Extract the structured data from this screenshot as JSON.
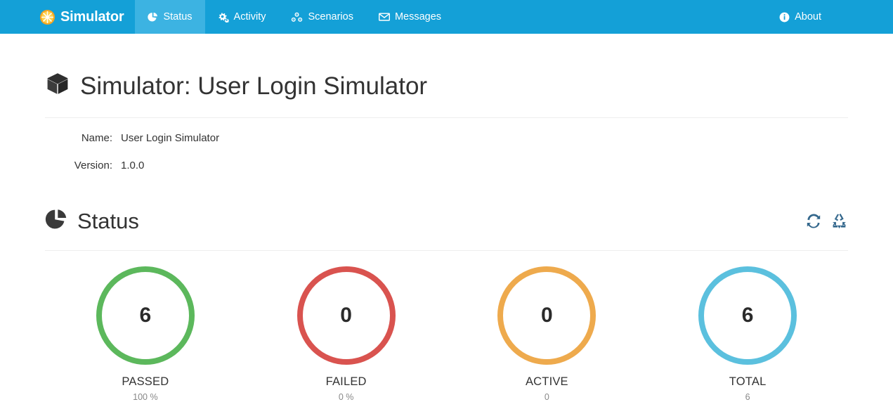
{
  "navbar": {
    "brand": {
      "label": "Simulator",
      "icon": "orange-slice-icon"
    },
    "background_color": "#14a0d7",
    "active_background_color": "#3cb3e2",
    "items": [
      {
        "label": "Status",
        "icon": "pie-chart-icon",
        "active": true
      },
      {
        "label": "Activity",
        "icon": "cogs-icon",
        "active": false
      },
      {
        "label": "Scenarios",
        "icon": "sitemap-icon",
        "active": false
      },
      {
        "label": "Messages",
        "icon": "envelope-icon",
        "active": false
      }
    ],
    "right_items": [
      {
        "label": "About",
        "icon": "info-circle-icon",
        "active": false
      }
    ]
  },
  "page": {
    "title": "Simulator: User Login Simulator",
    "title_icon": "cube-icon"
  },
  "details": {
    "rows": [
      {
        "label": "Name:",
        "value": "User Login Simulator"
      },
      {
        "label": "Version:",
        "value": "1.0.0"
      }
    ]
  },
  "status_section": {
    "title": "Status",
    "title_icon": "pie-chart-icon",
    "actions": [
      {
        "name": "refresh-icon",
        "color": "#33678c"
      },
      {
        "name": "recycle-icon",
        "color": "#33678c"
      }
    ],
    "stats": [
      {
        "value": "6",
        "label": "PASSED",
        "sub": "100 %",
        "color": "#5cb85c"
      },
      {
        "value": "0",
        "label": "FAILED",
        "sub": "0 %",
        "color": "#d9534f"
      },
      {
        "value": "0",
        "label": "ACTIVE",
        "sub": "0",
        "color": "#eeaa4d"
      },
      {
        "value": "6",
        "label": "TOTAL",
        "sub": "6",
        "color": "#5bc0de"
      }
    ]
  },
  "chart_data": {
    "type": "bar",
    "title": "Status",
    "categories": [
      "PASSED",
      "FAILED",
      "ACTIVE",
      "TOTAL"
    ],
    "values": [
      6,
      0,
      0,
      6
    ],
    "sublabels": [
      "100 %",
      "0 %",
      "0",
      "6"
    ],
    "colors": [
      "#5cb85c",
      "#d9534f",
      "#eeaa4d",
      "#5bc0de"
    ],
    "xlabel": "",
    "ylabel": "",
    "legend": false,
    "grid": false
  }
}
